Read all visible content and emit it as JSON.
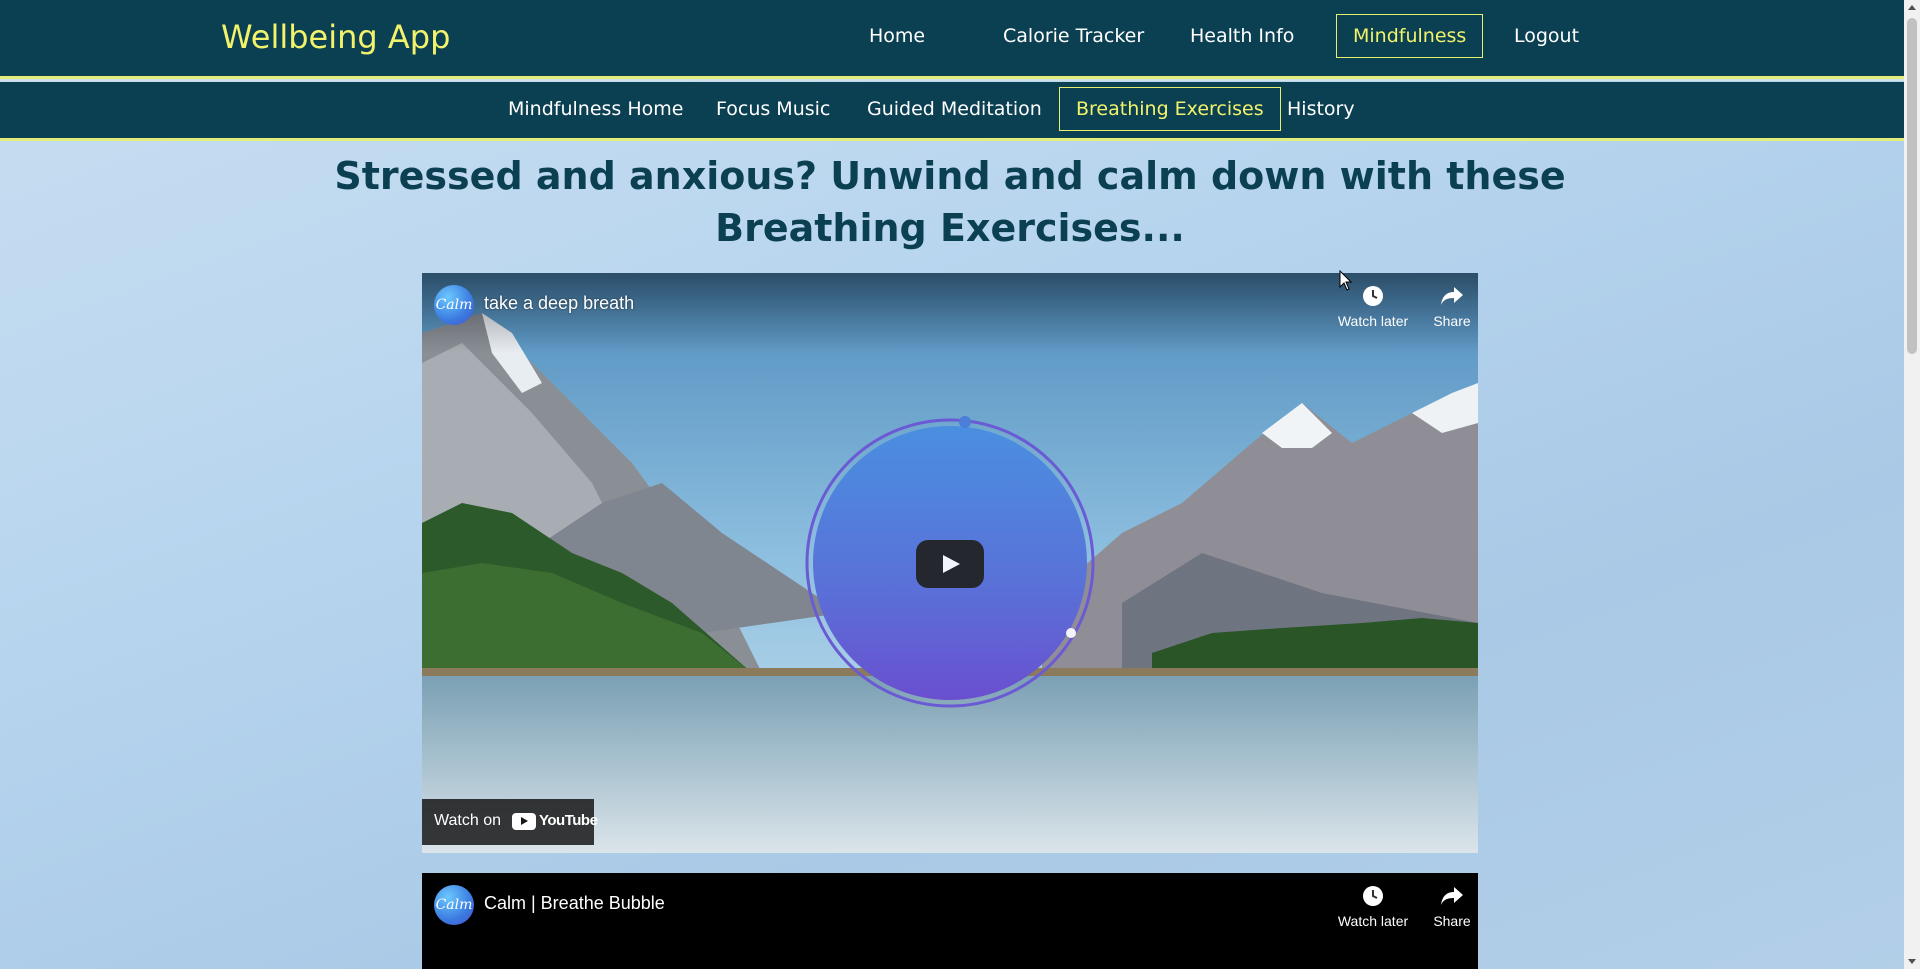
{
  "app": {
    "brand": "Wellbeing App"
  },
  "top_nav": {
    "items": [
      {
        "label": "Home",
        "active": false
      },
      {
        "label": "Calorie Tracker",
        "active": false
      },
      {
        "label": "Health Info",
        "active": false
      },
      {
        "label": "Mindfulness",
        "active": true
      },
      {
        "label": "Logout",
        "active": false
      }
    ]
  },
  "sub_nav": {
    "items": [
      {
        "label": "Mindfulness Home",
        "active": false
      },
      {
        "label": "Focus Music",
        "active": false
      },
      {
        "label": "Guided Meditation",
        "active": false
      },
      {
        "label": "Breathing Exercises",
        "active": true
      },
      {
        "label": "History",
        "active": false
      }
    ]
  },
  "main": {
    "heading": "Stressed and anxious? Unwind and calm down with these Breathing Exercises..."
  },
  "videos": [
    {
      "channel_avatar_text": "Calm",
      "title": "take a deep breath",
      "watch_later": "Watch later",
      "share": "Share",
      "watch_on": "Watch on",
      "youtube": "YouTube"
    },
    {
      "channel_avatar_text": "Calm",
      "title": "Calm | Breathe Bubble",
      "watch_later": "Watch later",
      "share": "Share"
    }
  ],
  "colors": {
    "nav_bg": "#0b3f52",
    "accent": "#f2f36a",
    "heading": "#0b3f52"
  }
}
